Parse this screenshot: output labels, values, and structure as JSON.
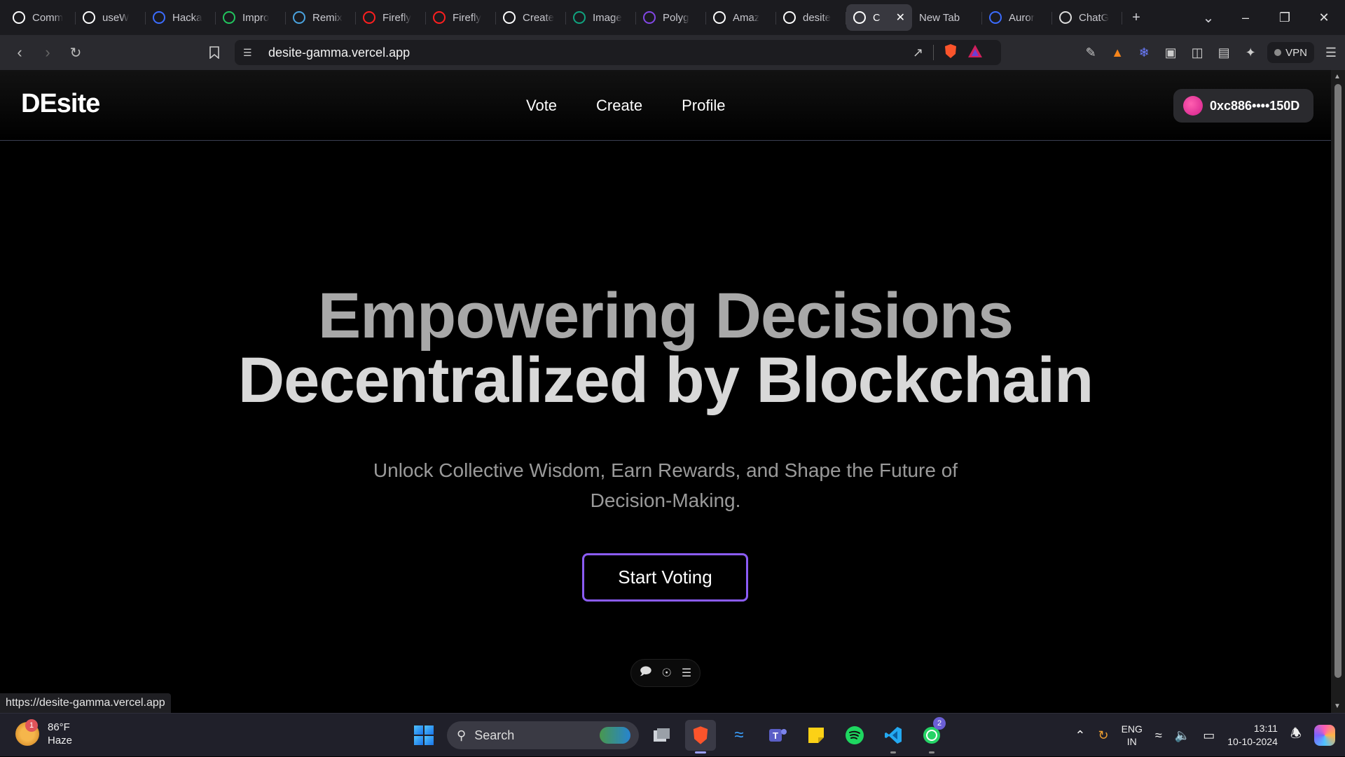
{
  "browser": {
    "tabs": [
      {
        "label": "Comm",
        "icon": "github-icon",
        "color": "#ffffff"
      },
      {
        "label": "useW",
        "icon": "wagmi-icon",
        "color": "#ffffff"
      },
      {
        "label": "Hacka",
        "icon": "hackathon-icon",
        "color": "#3b6cff"
      },
      {
        "label": "Impro",
        "icon": "codebase-icon",
        "color": "#22c55e"
      },
      {
        "label": "Remix",
        "icon": "remix-icon",
        "color": "#4aa3df"
      },
      {
        "label": "Firefly",
        "icon": "adobe-icon",
        "color": "#ff1f1f"
      },
      {
        "label": "Firefly",
        "icon": "adobe-icon",
        "color": "#ff1f1f"
      },
      {
        "label": "Create",
        "icon": "vercel-icon",
        "color": "#ffffff"
      },
      {
        "label": "Image",
        "icon": "chatgpt-icon",
        "color": "#10a37f"
      },
      {
        "label": "Polyg",
        "icon": "polygon-icon",
        "color": "#8247e5"
      },
      {
        "label": "Amaz",
        "icon": "amazon-icon",
        "color": "#ffffff"
      },
      {
        "label": "desite",
        "icon": "vercel-icon",
        "color": "#ffffff"
      }
    ],
    "active_tab": {
      "label": "C",
      "icon": "vercel-icon"
    },
    "extra_tabs": [
      {
        "label": "New Tab",
        "icon": "none"
      },
      {
        "label": "Auror",
        "icon": "aurora-icon",
        "color": "#3b6cff"
      },
      {
        "label": "ChatG",
        "icon": "chatgpt-icon",
        "color": "#dddddd"
      }
    ],
    "url": "desite-gamma.vercel.app",
    "vpn_label": "VPN",
    "status_url": "https://desite-gamma.vercel.app"
  },
  "site": {
    "logo": "DEsite",
    "nav": [
      "Vote",
      "Create",
      "Profile"
    ],
    "wallet_address": "0xc886••••150D",
    "hero_line1": "Empowering Decisions",
    "hero_line2": "Decentralized by Blockchain",
    "subtitle": "Unlock Collective Wisdom, Earn Rewards, and Shape the Future of Decision-Making.",
    "cta": "Start Voting",
    "accent": "#8b5cf6"
  },
  "taskbar": {
    "weather_temp": "86°F",
    "weather_desc": "Haze",
    "weather_badge": "1",
    "search_placeholder": "Search",
    "whatsapp_badge": "2",
    "lang_line1": "ENG",
    "lang_line2": "IN",
    "time": "13:11",
    "date": "10-10-2024"
  }
}
